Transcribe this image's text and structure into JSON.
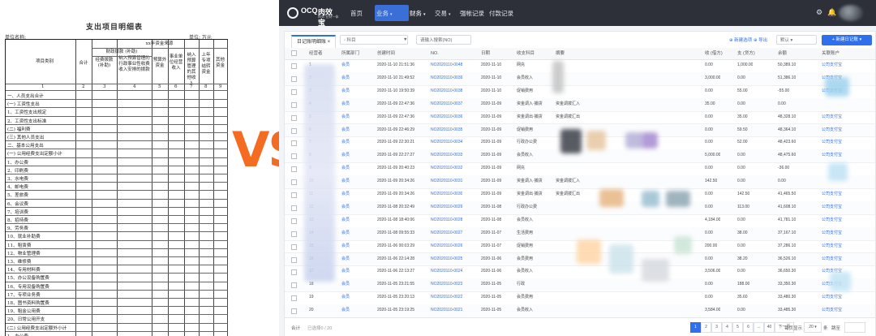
{
  "paper": {
    "title": "支出项目明细表",
    "unit_left": "单位名称:",
    "unit_right": "单位: 万元",
    "header_year": "xx年资金来源",
    "header_col_item": "项目类别",
    "header_col_total": "合计",
    "header_fiscal": "财政拨款 (补助)",
    "header_sub1": "经费拨款 (补助)",
    "header_sub2": "纳入预算管理的行政事业性收费收入安排的拨款",
    "header_sub3": "预算外资金",
    "header_sub4": "事业单位经营收入",
    "header_sub5": "纳入预算管理的其他收入",
    "header_sub6": "上年专项结转资金",
    "header_sub7": "其他资金",
    "col_numbers": [
      "1",
      "2",
      "3",
      "4",
      "5",
      "6",
      "7",
      "8",
      "9"
    ],
    "rows": [
      "一、人员支出合计",
      "(一) 工资性支出",
      "1、工资性支出规定",
      "2、工资性支出标准",
      "(二) 福利费",
      "(三) 其他人员支出",
      "二、基本公用支出",
      "(一) 公用经费支出定额小计",
      "1、办公费",
      "2、印刷费",
      "3、水电费",
      "4、邮电费",
      "5、差旅费",
      "6、会议费",
      "7、培训费",
      "8、招待费",
      "9、劳务费",
      "10、就业补助费",
      "11、租赁费",
      "12、物业管理费",
      "13、维修费",
      "14、专用材料费",
      "15、办公设备购置费",
      "16、专用设备购置费",
      "17、专项业务费",
      "18、图书资料购置费",
      "19、租金公用费",
      "20、日常公用开支",
      "(二) 公用经费支出定额外小计",
      "1、办公费"
    ]
  },
  "vs_text": "VS",
  "app": {
    "logo_text": "OCQ",
    "logo_cn": "肉效宝",
    "logo_sub": "财务·业财一体化",
    "nav": [
      {
        "label": "首页",
        "active": false
      },
      {
        "label": "业务",
        "active": false,
        "caret": true
      },
      {
        "label": "财务",
        "active": true,
        "caret": true
      },
      {
        "label": "交易",
        "active": false,
        "caret": true
      },
      {
        "label": "强帐记录",
        "active": false
      },
      {
        "label": "付款记录",
        "active": false
      }
    ],
    "top_icons": [
      "⚙",
      "🔔"
    ],
    "tab_label": "日记账明细账 ×",
    "filters": {
      "f1": "◦ 科目",
      "f2": "▼",
      "search_placeholder": "请输入搜索(NO)",
      "link1": "⊕ 新建选项",
      "link2": "⊕ 导出",
      "view_select": "默认 ▾",
      "primary_button": "+ 新建日记账 ▾"
    },
    "columns": [
      "",
      "经营者",
      "所属部门",
      "创建时间",
      "NO.",
      "日期",
      "收支科目",
      "摘要",
      "收 (借方)",
      "支 (贷方)",
      "余额",
      "关联账户"
    ],
    "rows": [
      [
        "",
        "1",
        "会员",
        "2020-11-10 21:51:36",
        "NO2020110-0048",
        "2020-11-10",
        "网充",
        "",
        "0.00",
        "1,000.00",
        "50,389.10",
        "公司支付宝"
      ],
      [
        "",
        "2",
        "会员",
        "2020-11-10 21:49:52",
        "NO2020110-0039",
        "2020-11-10",
        "会员收入",
        "",
        "3,000.00",
        "0.00",
        "51,386.10",
        "公司支付宝"
      ],
      [
        "",
        "3",
        "会员",
        "2020-11-10 19:50:39",
        "NO2020110-0038",
        "2020-11-10",
        "促销费用",
        "",
        "0.00",
        "55.00",
        "-55.00",
        "公司支付宝"
      ],
      [
        "",
        "4",
        "会员",
        "2020-11-09 22:47:36",
        "NO2020110-0037",
        "2020-11-09",
        "资金调入·捕货",
        "资金调拨汇入",
        "35.00",
        "0.00",
        "0.00",
        ""
      ],
      [
        "",
        "5",
        "会员",
        "2020-11-09 22:47:36",
        "NO2020110-0036",
        "2020-11-09",
        "资金调出·捕货",
        "资金调拨汇出",
        "0.00",
        "35.00",
        "48,328.10",
        "公司支付宝"
      ],
      [
        "",
        "6",
        "会员",
        "2020-11-09 22:46:29",
        "NO2020110-0035",
        "2020-11-09",
        "促销费用",
        "",
        "0.00",
        "59.50",
        "48,364.10",
        "公司支付宝"
      ],
      [
        "",
        "7",
        "会员",
        "2020-11-09 22:30:21",
        "NO2020110-0034",
        "2020-11-09",
        "行政办公费",
        "",
        "0.00",
        "52.00",
        "48,423.60",
        "公司支付宝"
      ],
      [
        "",
        "8",
        "会员",
        "2020-11-09 22:27:27",
        "NO2020110-0033",
        "2020-11-09",
        "会员收入",
        "",
        "5,000.00",
        "0.00",
        "48,475.60",
        "公司支付宝"
      ],
      [
        "",
        "9",
        "会员",
        "2020-11-09 20:40:23",
        "NO2020110-0032",
        "2020-11-09",
        "网充",
        "",
        "0.00",
        "0.00",
        "-36.00",
        ""
      ],
      [
        "",
        "10",
        "会员",
        "2020-11-09 20:34:26",
        "NO2020110-0031",
        "2020-11-09",
        "资金调入·捕货",
        "资金调拨汇入",
        "142.50",
        "0.00",
        "0.00",
        ""
      ],
      [
        "",
        "11",
        "会员",
        "2020-11-09 20:34:26",
        "NO2020110-0030",
        "2020-11-09",
        "资金调出·捕货",
        "资金调拨汇出",
        "0.00",
        "142.50",
        "41,465.50",
        "公司支付宝"
      ],
      [
        "",
        "12",
        "会员",
        "2020-11-08 20:32:49",
        "NO2020110-0029",
        "2020-11-08",
        "行政办公费",
        "",
        "0.00",
        "113.00",
        "41,608.10",
        "公司支付宝"
      ],
      [
        "",
        "13",
        "会员",
        "2020-11-08 18:40:06",
        "NO2020110-0028",
        "2020-11-08",
        "会员收入",
        "",
        "4,184.00",
        "0.00",
        "41,781.10",
        "公司支付宝"
      ],
      [
        "",
        "14",
        "会员",
        "2020-11-08 09:55:33",
        "NO2020110-0027",
        "2020-11-07",
        "生活费用",
        "",
        "0.00",
        "38.00",
        "37,167.10",
        "公司支付宝"
      ],
      [
        "",
        "15",
        "会员",
        "2020-11-06 00:03:29",
        "NO2020110-0026",
        "2020-11-07",
        "促销费用",
        "",
        "200.00",
        "0.00",
        "37,286.10",
        "公司支付宝"
      ],
      [
        "",
        "16",
        "会员",
        "2020-11-06 22:14:28",
        "NO2020110-0025",
        "2020-11-06",
        "会员费用",
        "",
        "0.00",
        "38.20",
        "36,526.10",
        "公司支付宝"
      ],
      [
        "",
        "17",
        "会员",
        "2020-11-06 22:13:27",
        "NO2020110-0024",
        "2020-11-06",
        "会员收入",
        "",
        "3,506.00",
        "0.00",
        "36,650.30",
        "公司支付宝"
      ],
      [
        "",
        "18",
        "会员",
        "2020-11-05 23:21:55",
        "NO2020110-0023",
        "2020-11-05",
        "行政",
        "",
        "0.00",
        "188.00",
        "33,350.30",
        "公司支付宝"
      ],
      [
        "",
        "19",
        "会员",
        "2020-11-05 23:20:13",
        "NO2020110-0022",
        "2020-11-05",
        "会员费用",
        "",
        "0.00",
        "35.60",
        "33,480.30",
        "公司支付宝"
      ],
      [
        "",
        "20",
        "会员",
        "2020-11-05 23:19:25",
        "NO2020110-0021",
        "2020-11-05",
        "会员收入",
        "",
        "3,584.00",
        "0.00",
        "33,485.30",
        "公司支付宝"
      ]
    ],
    "footer": {
      "total_label": "合计",
      "selected_label": "已选择0 / 20",
      "pages": [
        "1",
        "2",
        "3",
        "4",
        "5",
        "6",
        "...",
        "40"
      ],
      "next_label": "下一页",
      "page_size_label": "每页显示",
      "page_size_value": "20 ▾",
      "page_size_unit": "条",
      "goto_label": "跳至"
    }
  }
}
